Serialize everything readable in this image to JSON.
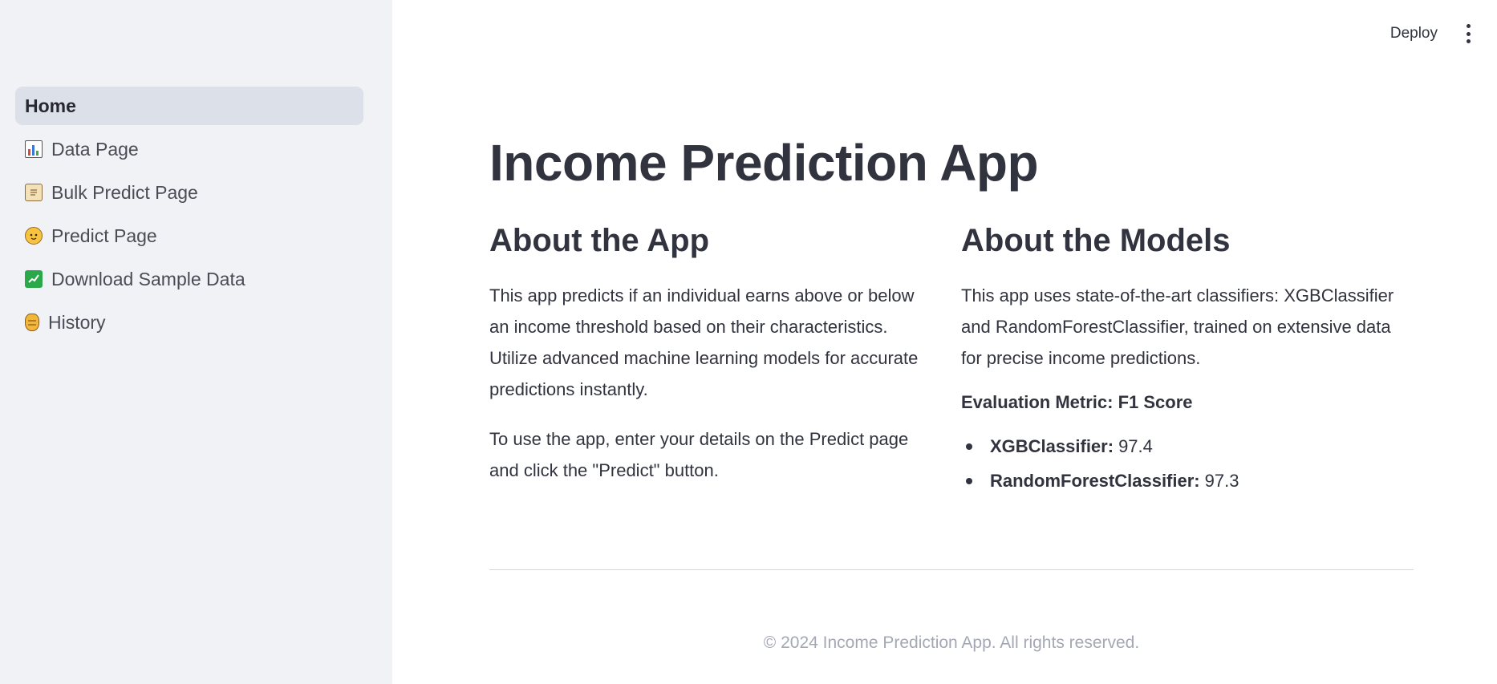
{
  "header": {
    "deploy_label": "Deploy",
    "menu_icon": "kebab-menu-icon"
  },
  "sidebar": {
    "items": [
      {
        "label": "Home",
        "icon": "",
        "active": true
      },
      {
        "label": "Data Page",
        "icon": "bar-chart-icon",
        "active": false
      },
      {
        "label": "Bulk Predict Page",
        "icon": "scroll-icon",
        "active": false
      },
      {
        "label": "Predict Page",
        "icon": "child-face-icon",
        "active": false
      },
      {
        "label": "Download Sample Data",
        "icon": "chart-increasing-icon",
        "active": false
      },
      {
        "label": "History",
        "icon": "amphora-icon",
        "active": false
      }
    ]
  },
  "main": {
    "title": "Income Prediction App",
    "about_app": {
      "heading": "About the App",
      "paragraph1": "This app predicts if an individual earns above or below an income threshold based on their characteristics. Utilize advanced machine learning models for accurate predictions instantly.",
      "paragraph2": "To use the app, enter your details on the Predict page and click the \"Predict\" button."
    },
    "about_models": {
      "heading": "About the Models",
      "paragraph": "This app uses state-of-the-art classifiers: XGBClassifier and RandomForestClassifier, trained on extensive data for precise income predictions.",
      "metric_heading": "Evaluation Metric: F1 Score",
      "models": [
        {
          "name": "XGBClassifier:",
          "score": "97.4"
        },
        {
          "name": "RandomForestClassifier:",
          "score": "97.3"
        }
      ]
    },
    "footer": "© 2024 Income Prediction App. All rights reserved."
  },
  "colors": {
    "sidebar_bg": "#f0f2f6",
    "active_item_bg": "#dce0e8",
    "text": "#31333f",
    "footer_text": "#a3a8b4"
  }
}
